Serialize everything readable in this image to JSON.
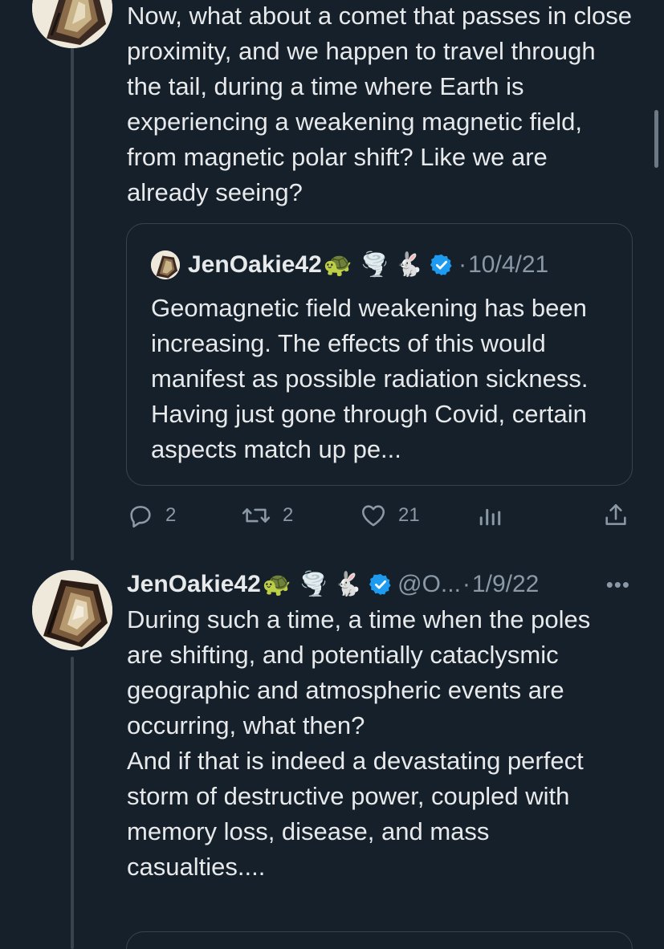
{
  "tweet1": {
    "text": "Now, what about a comet that passes in close proximity, and we happen to travel through the tail, during a time where Earth is experiencing a weakening magnetic field, from magnetic polar shift? Like we are already seeing?"
  },
  "quote": {
    "name": "JenOakie42",
    "emojis": [
      "🐢",
      "🌪️",
      "🐇"
    ],
    "verified_icon": "verified-badge-icon",
    "separator": "·",
    "date": "10/4/21",
    "text": "Geomagnetic field weakening has been increasing. The effects of this would manifest as possible radiation sickness. Having just gone through Covid, certain aspects match up pe..."
  },
  "actions": {
    "replies": "2",
    "retweets": "2",
    "likes": "21",
    "icons": [
      "reply-icon",
      "retweet-icon",
      "like-icon",
      "views-icon",
      "share-icon"
    ]
  },
  "tweet2": {
    "name": "JenOakie42",
    "emojis": [
      "🐢",
      "🌪️",
      "🐇"
    ],
    "handle": "@O...",
    "separator": "·",
    "date": "1/9/22",
    "more": "•••",
    "text": "During such a time, a time when the poles are shifting, and potentially cataclysmic geographic and atmospheric events are occurring, what then?\nAnd if that is indeed a devastating perfect storm of destructive power, coupled with memory loss, disease, and mass casualties...."
  },
  "colors": {
    "background": "#15202b",
    "text": "#e7e9ea",
    "secondary": "#8b98a5",
    "border": "#38444d",
    "verified": "#1d9bf0"
  }
}
